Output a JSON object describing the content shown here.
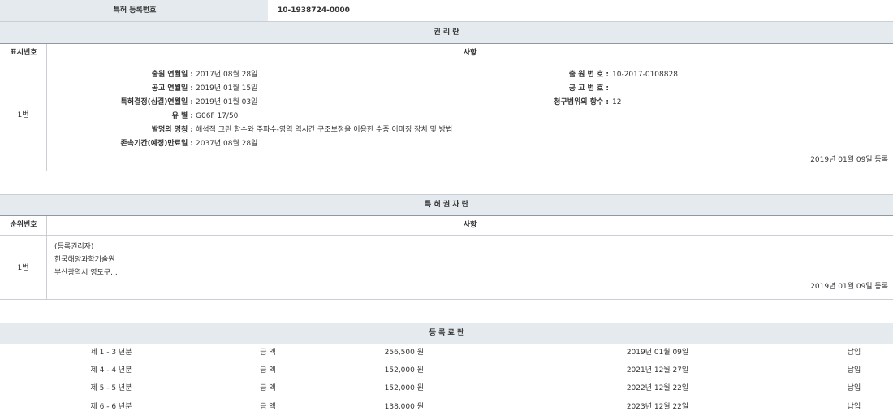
{
  "registration": {
    "label": "특허 등록번호",
    "number": "10-1938724-0000"
  },
  "rights_section": {
    "title": "권 리 란",
    "col_index": "표시번호",
    "col_matters": "사항",
    "row_index": "1번",
    "left_fields": [
      {
        "label": "출원 연월일 :",
        "value": "2017년 08월 28일"
      },
      {
        "label": "공고 연월일 :",
        "value": "2019년 01월 15일"
      },
      {
        "label": "특허결정(심결)연월일 :",
        "value": "2019년 01월 03일"
      },
      {
        "label": "유 별 :",
        "value": "G06F 17/50"
      },
      {
        "label": "발명의 명칭 :",
        "value": "해석적 그린 함수와 주파수-영역 역시간 구조보정을 이용한 수중 이미징 장치 및 방법"
      },
      {
        "label": "존속기간(예정)만료일 :",
        "value": "2037년 08월 28일"
      }
    ],
    "right_fields": [
      {
        "label": "출 원 번 호 :",
        "value": "10-2017-0108828"
      },
      {
        "label": "공 고 번 호 :",
        "value": ""
      },
      {
        "label": "청구범위의 항수 :",
        "value": "12"
      }
    ],
    "registered_note": "2019년 01월 09일 등록"
  },
  "patentee_section": {
    "title": "특 허 권 자 란",
    "col_index": "순위번호",
    "col_matters": "사항",
    "row_index": "1번",
    "role": "(등록권리자)",
    "name": "한국해양과학기술원",
    "address": "부산광역시 영도구...",
    "registered_note": "2019년 01월 09일 등록"
  },
  "fee_section": {
    "title": "등 록 료 란",
    "rows": [
      {
        "period": "제 1 - 3 년분",
        "amount_label": "금 액",
        "amount": "256,500 원",
        "date": "2019년 01월 09일",
        "status": "납입"
      },
      {
        "period": "제 4 - 4 년분",
        "amount_label": "금 액",
        "amount": "152,000 원",
        "date": "2021년 12월 27일",
        "status": "납입"
      },
      {
        "period": "제 5 - 5 년분",
        "amount_label": "금 액",
        "amount": "152,000 원",
        "date": "2022년 12월 22일",
        "status": "납입"
      },
      {
        "period": "제 6 - 6 년분",
        "amount_label": "금 액",
        "amount": "138,000 원",
        "date": "2023년 12월 22일",
        "status": "납입"
      }
    ]
  },
  "colors": {
    "header_bg": "#e5eaee",
    "border_light": "#c9cfd5",
    "border_dark": "#8e99a3",
    "text": "#333333"
  }
}
